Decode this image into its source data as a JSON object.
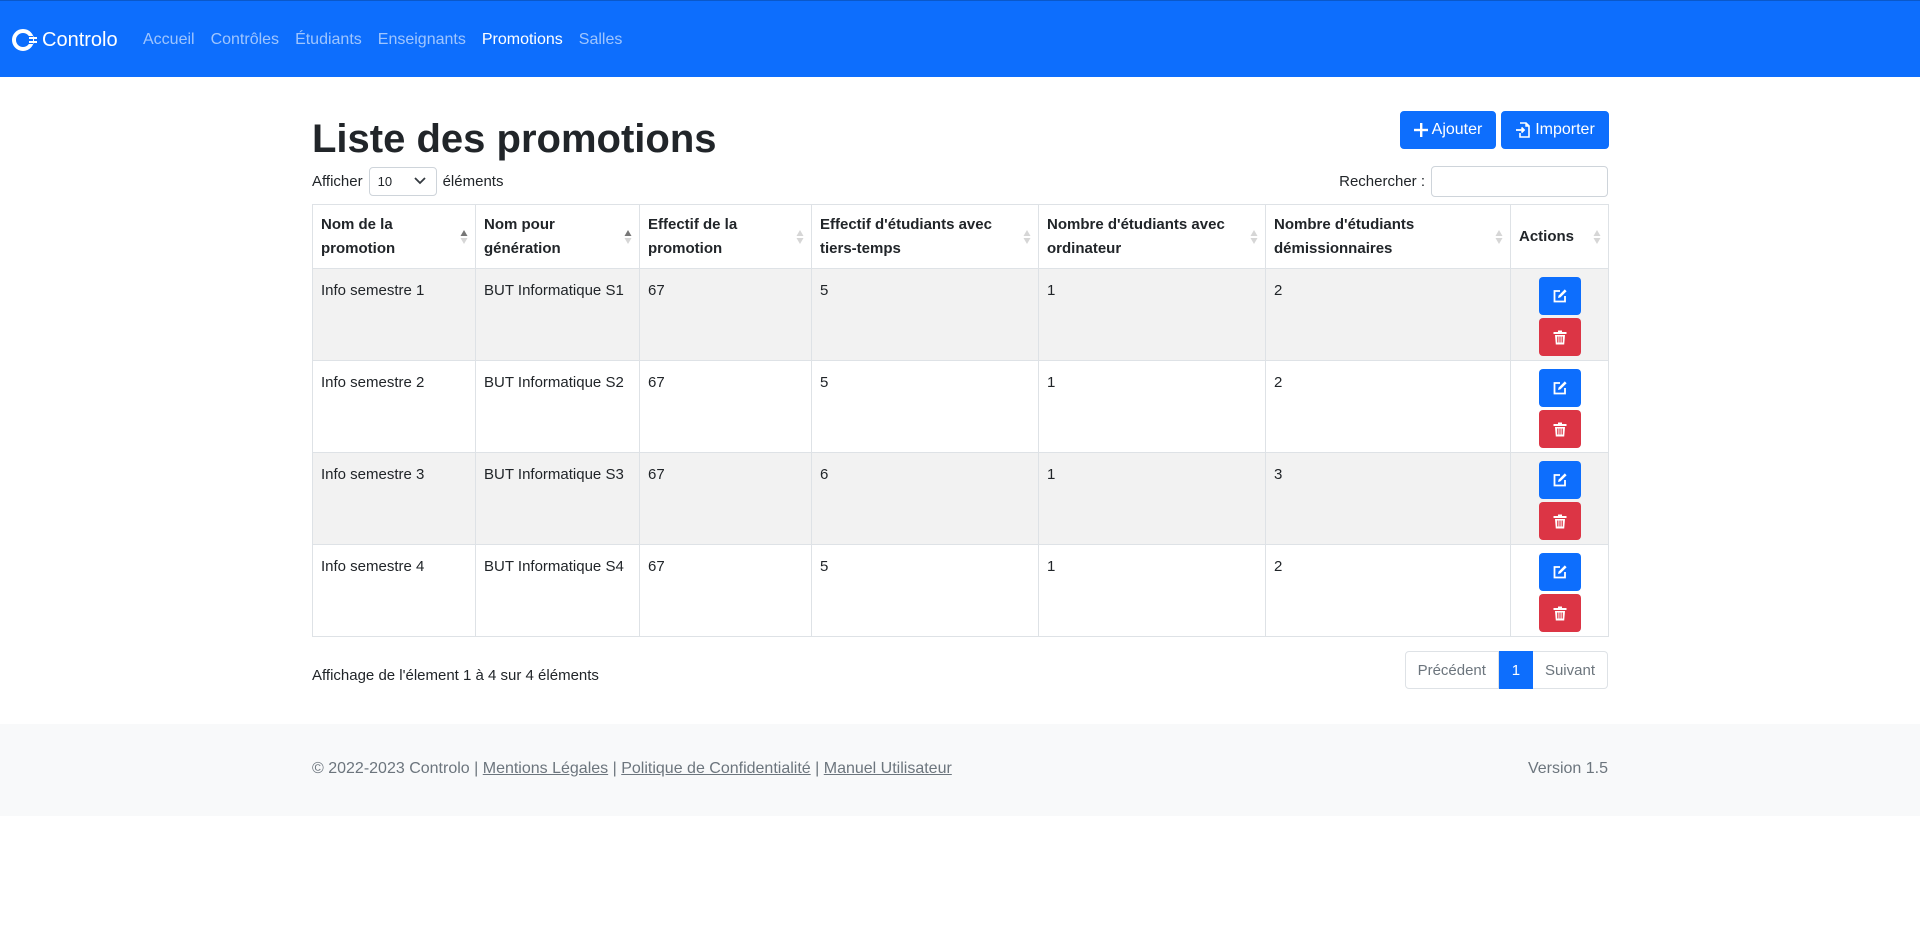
{
  "navbar": {
    "brand": "Controlo",
    "links": [
      {
        "label": "Accueil"
      },
      {
        "label": "Contrôles"
      },
      {
        "label": "Étudiants"
      },
      {
        "label": "Enseignants"
      },
      {
        "label": "Promotions",
        "active": true
      },
      {
        "label": "Salles"
      }
    ]
  },
  "page": {
    "title": "Liste des promotions",
    "add_label": "Ajouter",
    "import_label": "Importer"
  },
  "table_controls": {
    "show_label": "Afficher",
    "page_length": "10",
    "elements_label": "éléments",
    "search_label": "Rechercher :",
    "search_value": ""
  },
  "table": {
    "headers": [
      "Nom de la promotion",
      "Nom pour génération",
      "Effectif de la promotion",
      "Effectif d'étudiants avec tiers-temps",
      "Nombre d'étudiants avec ordinateur",
      "Nombre d'étudiants démissionnaires",
      "Actions"
    ],
    "rows": [
      [
        "Info semestre 1",
        "BUT Informatique S1",
        "67",
        "5",
        "1",
        "2"
      ],
      [
        "Info semestre 2",
        "BUT Informatique S2",
        "67",
        "5",
        "1",
        "2"
      ],
      [
        "Info semestre 3",
        "BUT Informatique S3",
        "67",
        "6",
        "1",
        "3"
      ],
      [
        "Info semestre 4",
        "BUT Informatique S4",
        "67",
        "5",
        "1",
        "2"
      ]
    ]
  },
  "pagination": {
    "info": "Affichage de l'élement 1 à 4 sur 4 éléments",
    "prev": "Précédent",
    "current": "1",
    "next": "Suivant"
  },
  "footer": {
    "copyright": "© 2022-2023 Controlo |",
    "sep": "|",
    "links": [
      "Mentions Légales",
      "Politique de Confidentialité",
      "Manuel Utilisateur"
    ],
    "version": "Version 1.5"
  },
  "colors": {
    "primary": "#0d6efd",
    "danger": "#dc3545",
    "footer_bg": "#f8f9fa",
    "stripe": "#f2f2f2"
  },
  "icons": {
    "brand": "controlo-logo-icon",
    "add": "plus-icon",
    "import": "file-import-icon",
    "select": "chevron-down-icon",
    "sort": "sort-icon",
    "edit": "edit-icon",
    "delete": "trash-icon"
  }
}
